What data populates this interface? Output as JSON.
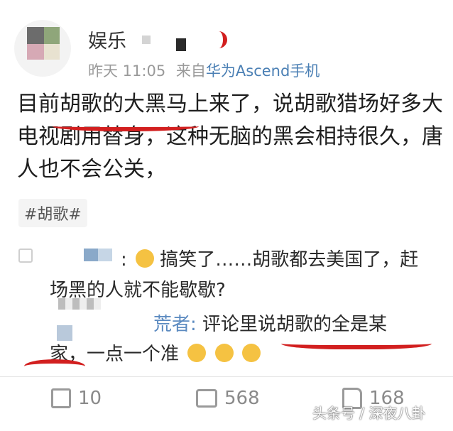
{
  "post": {
    "username": "娱乐",
    "time": "昨天 11:05",
    "source_prefix": "来自",
    "device": "华为Ascend手机",
    "text": "目前胡歌的大黑马上来了，说胡歌猎场好多大电视剧用替身，这种无脑的黑会相持很久，唐人也不会公关，",
    "hashtag": "#胡歌#"
  },
  "comments": [
    {
      "author_suffix": ":",
      "text_line1": "搞笑了……胡歌都去美国了，赶",
      "text_line2": "场黑的人就不能歇歇?"
    },
    {
      "author_suffix": "荒者:",
      "text_line1": "评论里说胡歌的全是某",
      "text_line2": "家，一点一个准"
    }
  ],
  "footer": {
    "share_count": "10",
    "comment_count": "568",
    "like_count": "168"
  },
  "watermark": "头条号 / 深夜八卦"
}
